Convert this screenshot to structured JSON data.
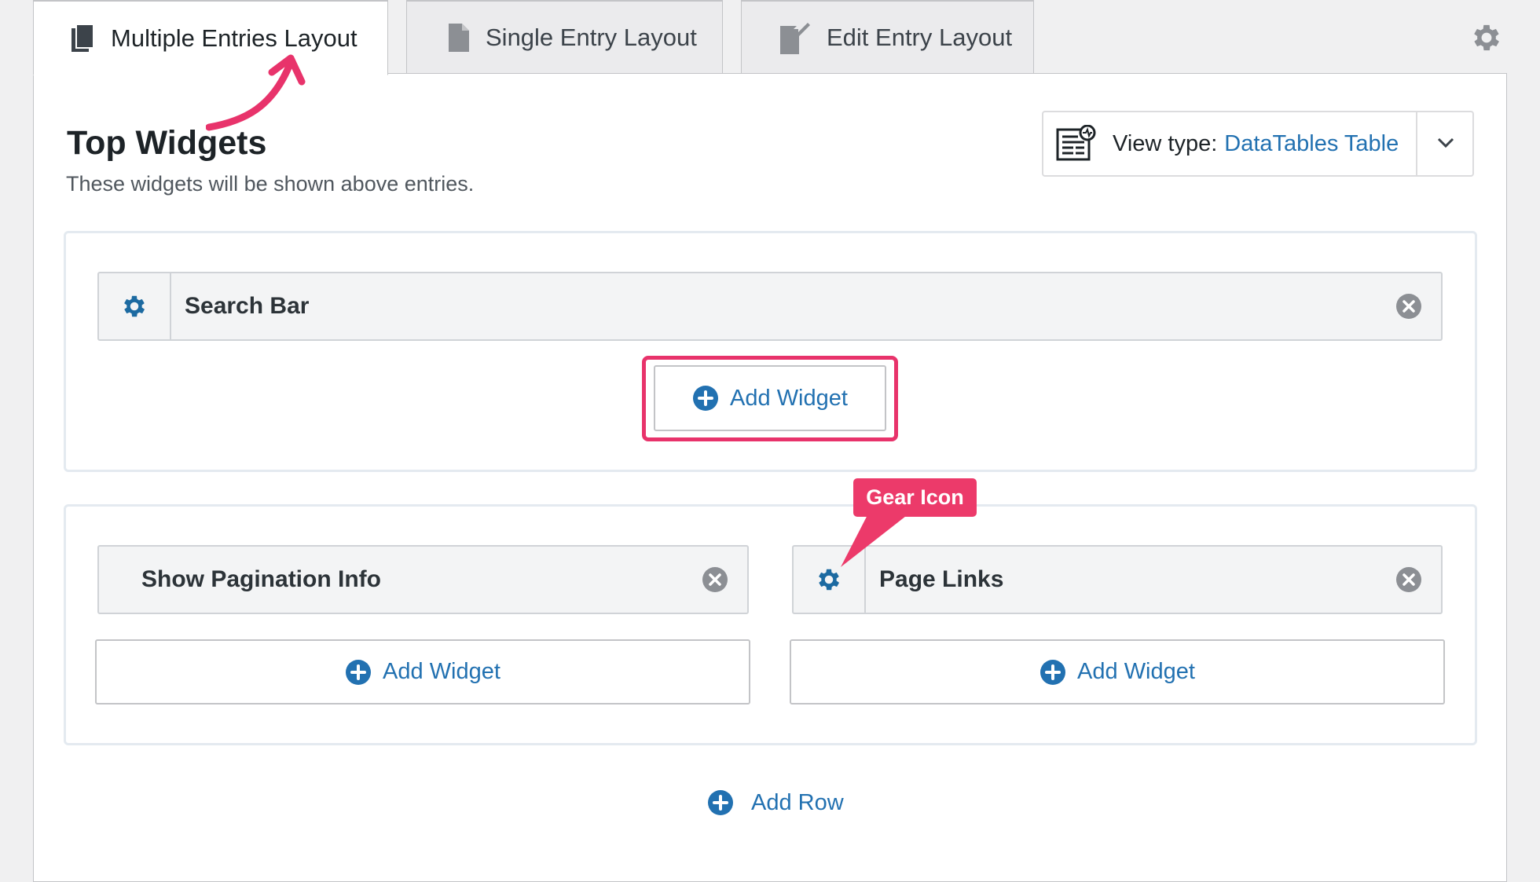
{
  "tabs": [
    {
      "label": "Multiple Entries Layout",
      "active": true,
      "icon": "copy-pages-icon"
    },
    {
      "label": "Single Entry Layout",
      "active": false,
      "icon": "document-icon"
    },
    {
      "label": "Edit Entry Layout",
      "active": false,
      "icon": "edit-document-icon"
    }
  ],
  "section": {
    "title": "Top Widgets",
    "description": "These widgets will be shown above entries."
  },
  "view_type": {
    "label": "View type:",
    "value": "DataTables Table"
  },
  "areas": {
    "top": {
      "widgets": [
        {
          "label": "Search Bar",
          "has_settings": true
        }
      ],
      "add_button": "Add Widget"
    },
    "bottom": {
      "left": {
        "widget": {
          "label": "Show Pagination Info",
          "has_settings": false
        },
        "add_button": "Add Widget"
      },
      "right": {
        "widget": {
          "label": "Page Links",
          "has_settings": true
        },
        "add_button": "Add Widget"
      }
    }
  },
  "add_row": "Add Row",
  "annotations": {
    "callout": "Gear Icon"
  },
  "colors": {
    "accent_link": "#2271b1",
    "gear_blue": "#1c6aa1",
    "annotation_pink": "#ec3a6a",
    "highlight_border": "#e8336b"
  }
}
